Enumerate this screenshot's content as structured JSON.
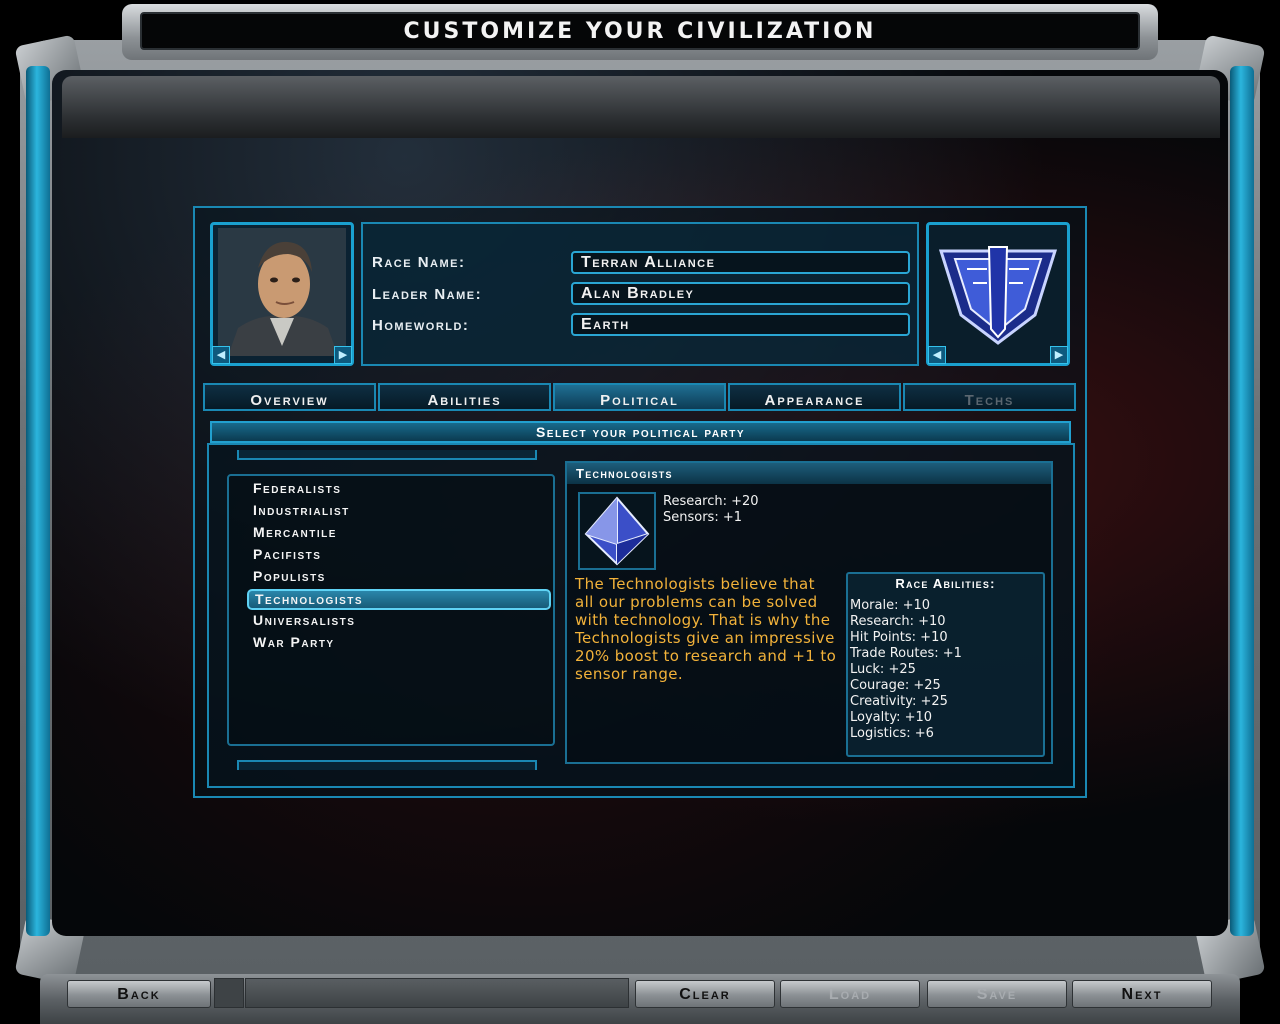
{
  "window": {
    "title": "CUSTOMIZE YOUR CIVILIZATION"
  },
  "identity": {
    "race_label": "Race Name:",
    "race_value": "Terran Alliance",
    "leader_label": "Leader Name:",
    "leader_value": "Alan Bradley",
    "homeworld_label": "Homeworld:",
    "homeworld_value": "Earth"
  },
  "tabs": [
    {
      "label": "Overview",
      "state": "normal"
    },
    {
      "label": "Abilities",
      "state": "normal"
    },
    {
      "label": "Political",
      "state": "active"
    },
    {
      "label": "Appearance",
      "state": "normal"
    },
    {
      "label": "Techs",
      "state": "disabled"
    }
  ],
  "section": {
    "title": "Select your political party"
  },
  "parties": [
    "Federalists",
    "Industrialist",
    "Mercantile",
    "Pacifists",
    "Populists",
    "Technologists",
    "Universalists",
    "War Party"
  ],
  "selected_party": "Technologists",
  "detail": {
    "title": "Technologists",
    "bonuses": [
      "Research: +20",
      "Sensors: +1"
    ],
    "description": "The Technologists believe that all our problems can be solved with technology. That is why the Technologists give an impressive 20% boost to research and +1 to sensor range."
  },
  "race_abilities": {
    "title": "Race Abilities:",
    "items": [
      "Morale: +10",
      "Research: +10",
      "Hit Points: +10",
      "Trade Routes: +1",
      "Luck: +25",
      "Courage: +25",
      "Creativity: +25",
      "Loyalty: +10",
      "Logistics: +6"
    ]
  },
  "buttons": {
    "back": "Back",
    "clear": "Clear",
    "load": "Load",
    "save": "Save",
    "next": "Next"
  },
  "icons": {
    "prev": "triangle-left-icon",
    "next": "triangle-right-icon",
    "emblem": "terran-alliance-emblem-icon",
    "party": "technologists-octahedron-icon"
  },
  "colors": {
    "accent": "#1aa0cf",
    "description_text": "#f2b23a",
    "selected_row": "#2a86aa"
  }
}
